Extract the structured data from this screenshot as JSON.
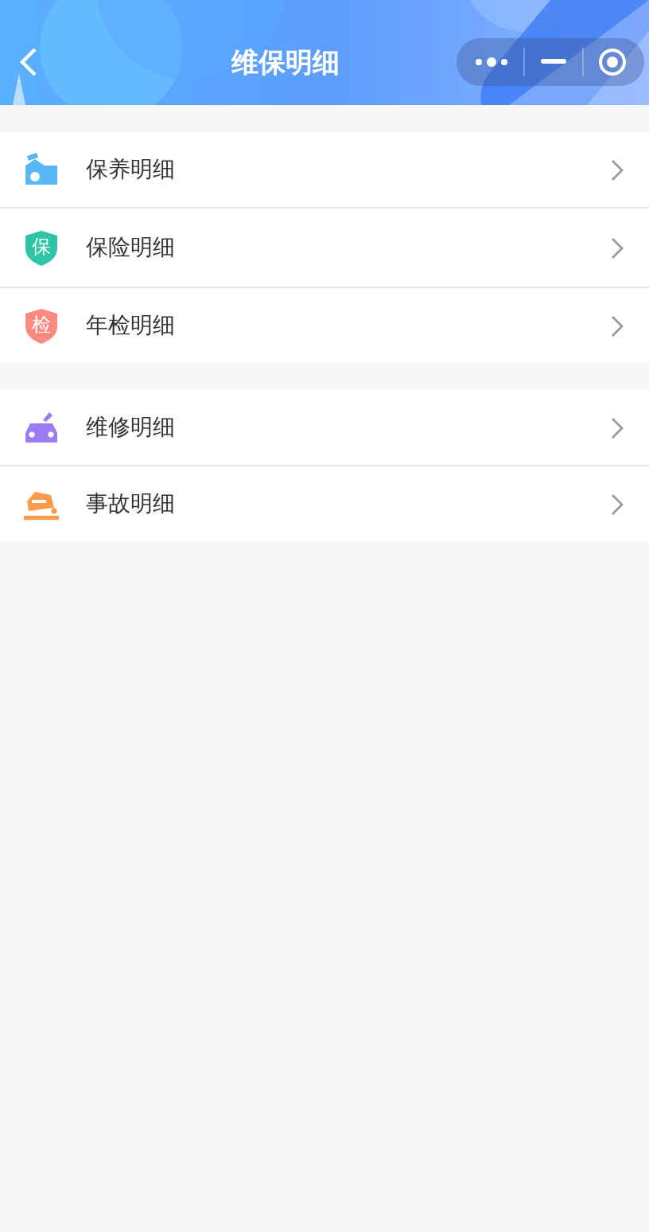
{
  "header": {
    "title": "维保明细"
  },
  "groups": [
    {
      "items": [
        {
          "label": "保养明细",
          "kind": "repair"
        },
        {
          "label": "保险明细",
          "kind": "shield",
          "icon_text": "保",
          "color": "#2ec4a6"
        },
        {
          "label": "年检明细",
          "kind": "shield",
          "icon_text": "检",
          "color": "#ff8a80"
        }
      ]
    },
    {
      "items": [
        {
          "label": "维修明细",
          "kind": "wrench"
        },
        {
          "label": "事故明细",
          "kind": "crash"
        }
      ]
    }
  ]
}
